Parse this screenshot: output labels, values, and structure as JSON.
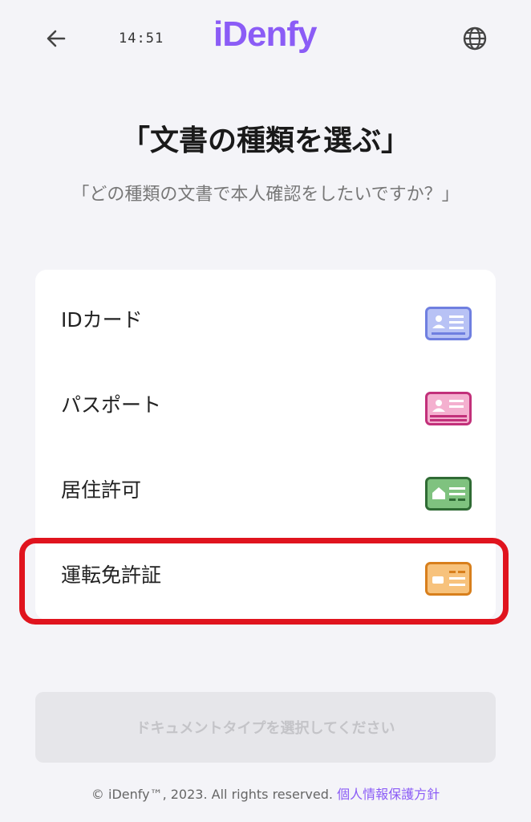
{
  "header": {
    "time": "14:51",
    "logo": "iDenfy",
    "back_icon": "arrow-left-icon",
    "language_icon": "globe-icon"
  },
  "title": "「文書の種類を選ぶ」",
  "subtitle": "「どの種類の文書で本人確認をしたいですか？」",
  "documents": [
    {
      "label": "IDカード",
      "icon": "id-card-icon",
      "color": "#6f7fe0"
    },
    {
      "label": "パスポート",
      "icon": "passport-icon",
      "color": "#e26aa3"
    },
    {
      "label": "居住許可",
      "icon": "residence-permit-icon",
      "color": "#4f9a55"
    },
    {
      "label": "運転免許証",
      "icon": "driver-license-icon",
      "color": "#f0a24a"
    }
  ],
  "highlight_color": "#e0141e",
  "submit_label": "ドキュメントタイプを選択してください",
  "footer": {
    "copyright": "© iDenfy™, 2023. All rights reserved.",
    "privacy_link": "個人情報保護方針"
  },
  "accent": "#8b5cf6"
}
